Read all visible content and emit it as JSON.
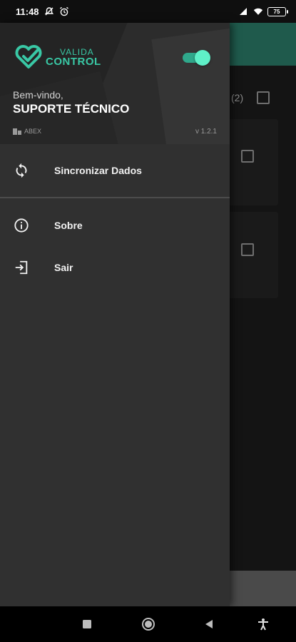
{
  "status_bar": {
    "time": "11:48",
    "icons": [
      "mute-icon",
      "alarm-icon",
      "signal-icon",
      "wifi-icon"
    ],
    "battery": "75"
  },
  "background": {
    "count_label": "(2)"
  },
  "drawer": {
    "brand": {
      "line1": "VALIDA",
      "line2": "CONTROL"
    },
    "welcome": "Bem-vindo,",
    "user_name": "SUPORTE TÉCNICO",
    "company": "ABEX",
    "version": "v 1.2.1",
    "toggle_on": true,
    "menu": [
      {
        "label": "Sincronizar Dados",
        "icon": "sync-icon"
      },
      {
        "label": "Sobre",
        "icon": "info-icon"
      },
      {
        "label": "Sair",
        "icon": "logout-icon"
      }
    ]
  },
  "nav_bar": {
    "buttons": [
      "recents-square-icon",
      "home-circle-icon",
      "back-triangle-icon",
      "accessibility-icon"
    ]
  },
  "colors": {
    "accent": "#39c8a5",
    "drawer_bg": "#303030",
    "header_bg": "#242424"
  }
}
